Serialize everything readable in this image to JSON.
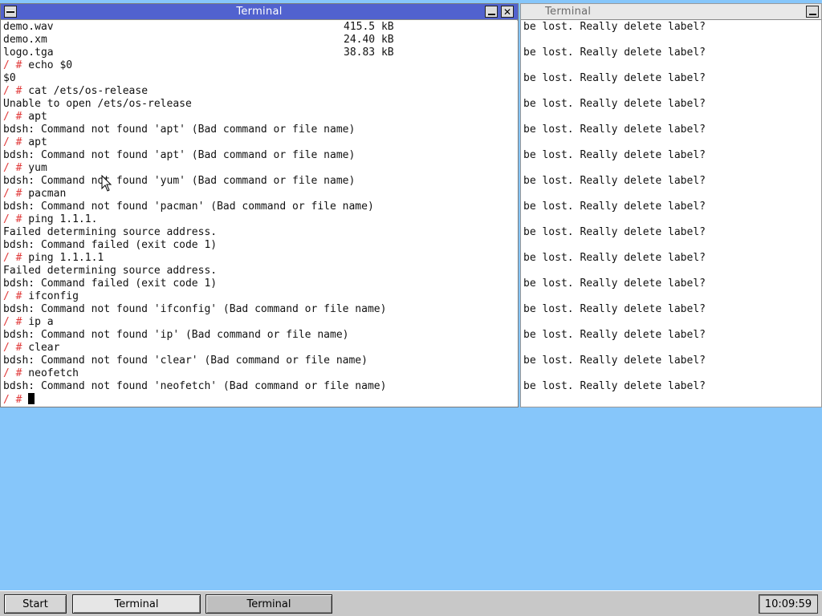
{
  "windows": {
    "left": {
      "title": "Terminal",
      "files": [
        {
          "name": "demo.wav",
          "size": "415.5 kB"
        },
        {
          "name": "demo.xm",
          "size": "24.40 kB"
        },
        {
          "name": "logo.tga",
          "size": "38.83 kB"
        }
      ],
      "prompt_symbol": "/ #",
      "lines": [
        {
          "type": "cmd",
          "text": "echo $0"
        },
        {
          "type": "out",
          "text": "$0"
        },
        {
          "type": "cmd",
          "text": "cat /ets/os-release"
        },
        {
          "type": "out",
          "text": "Unable to open /ets/os-release"
        },
        {
          "type": "cmd",
          "text": "apt"
        },
        {
          "type": "out",
          "text": "bdsh: Command not found 'apt' (Bad command or file name)"
        },
        {
          "type": "cmd",
          "text": "apt"
        },
        {
          "type": "out",
          "text": "bdsh: Command not found 'apt' (Bad command or file name)"
        },
        {
          "type": "cmd",
          "text": "yum"
        },
        {
          "type": "out",
          "text": "bdsh: Command not found 'yum' (Bad command or file name)"
        },
        {
          "type": "cmd",
          "text": "pacman"
        },
        {
          "type": "out",
          "text": "bdsh: Command not found 'pacman' (Bad command or file name)"
        },
        {
          "type": "cmd",
          "text": "ping 1.1.1."
        },
        {
          "type": "out",
          "text": "Failed determining source address."
        },
        {
          "type": "out",
          "text": "bdsh: Command failed (exit code 1)"
        },
        {
          "type": "cmd",
          "text": "ping 1.1.1.1"
        },
        {
          "type": "out",
          "text": "Failed determining source address."
        },
        {
          "type": "out",
          "text": "bdsh: Command failed (exit code 1)"
        },
        {
          "type": "cmd",
          "text": "ifconfig"
        },
        {
          "type": "out",
          "text": "bdsh: Command not found 'ifconfig' (Bad command or file name)"
        },
        {
          "type": "cmd",
          "text": "ip a"
        },
        {
          "type": "out",
          "text": "bdsh: Command not found 'ip' (Bad command or file name)"
        },
        {
          "type": "cmd",
          "text": "clear"
        },
        {
          "type": "out",
          "text": "bdsh: Command not found 'clear' (Bad command or file name)"
        },
        {
          "type": "cmd",
          "text": "neofetch"
        },
        {
          "type": "out",
          "text": "bdsh: Command not found 'neofetch' (Bad command or file name)"
        }
      ]
    },
    "right": {
      "title": "Terminal",
      "message": "be lost. Really delete label?",
      "message_count": 15
    }
  },
  "taskbar": {
    "start_label": "Start",
    "tasks": [
      "Terminal",
      "Terminal"
    ],
    "clock": "10:09:59"
  },
  "icons": {
    "menu": "window-menu-icon",
    "minimize": "minimize-icon",
    "close": "close-icon",
    "pointer": "mouse-pointer-icon"
  },
  "colors": {
    "desktop": "#86c6fa",
    "active_title": "#5162cf",
    "prompt": "#e03a3a"
  }
}
